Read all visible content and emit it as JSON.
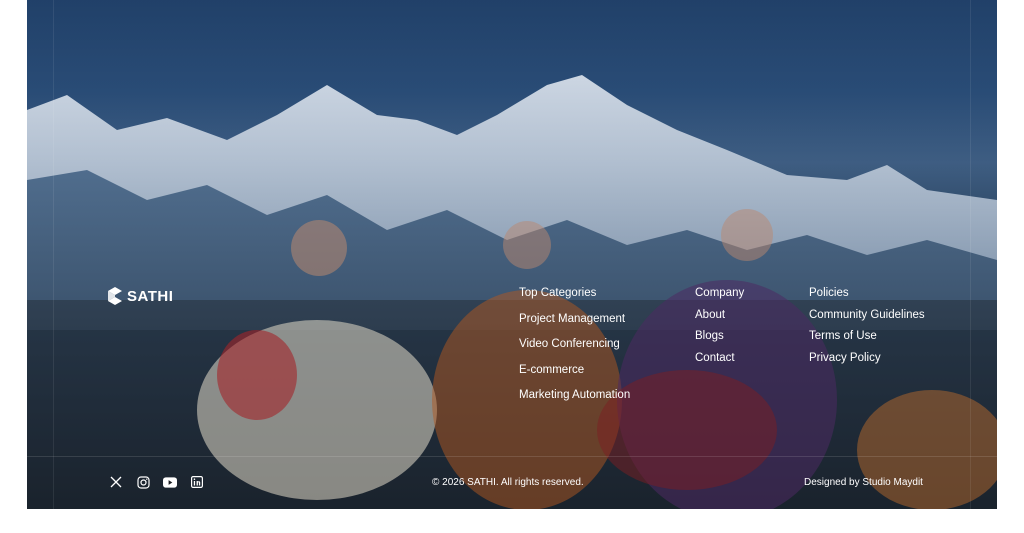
{
  "brand": {
    "name": "SATHI",
    "icon": "sathi-logo-icon"
  },
  "nav": {
    "categories": [
      "Top Categories",
      "Project Management",
      "Video Conferencing",
      "E-commerce",
      "Marketing Automation"
    ],
    "company": [
      "Company",
      "About",
      "Blogs",
      "Contact"
    ],
    "policies": [
      "Policies",
      "Community Guidelines",
      "Terms of Use",
      "Privacy Policy"
    ]
  },
  "socials": [
    "x-icon",
    "instagram-icon",
    "youtube-icon",
    "linkedin-icon"
  ],
  "footer": {
    "copyright": "© 2026 SATHI. All rights reserved.",
    "credit": "Designed by Studio Maydit"
  },
  "colors": {
    "text": "#ffffff",
    "background": "#ffffff",
    "panel_sky": "#2f5684",
    "panel_dark": "#15181c"
  }
}
